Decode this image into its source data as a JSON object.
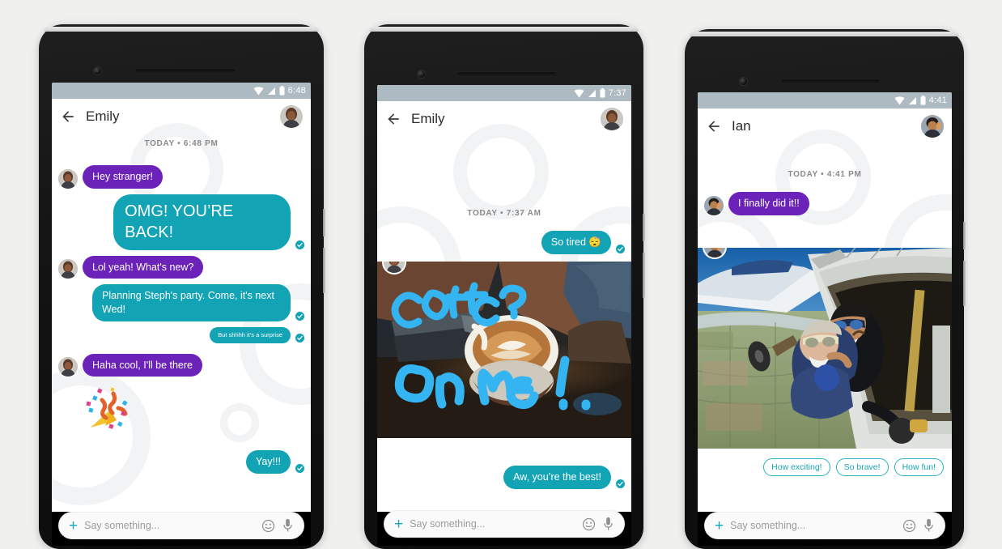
{
  "page": {
    "background": "#f0f0ef"
  },
  "colors": {
    "them_bubble": "#6b22b8",
    "me_bubble": "#12a3b4",
    "accent": "#18a9b6",
    "statusbar": "#adbac2",
    "chip_border": "#27b3c0"
  },
  "phones": [
    {
      "id": "phone-1",
      "status": {
        "time": "6:48",
        "icons": [
          "wifi-icon",
          "signal-icon",
          "battery-icon"
        ]
      },
      "appbar": {
        "back": "back-arrow-icon",
        "title": "Emily",
        "avatar": "contact-avatar-emily"
      },
      "daystamp": "TODAY • 6:48 PM",
      "messages": [
        {
          "side": "them",
          "text": "Hey stranger!",
          "avatar": true,
          "size": "normal",
          "tick": false
        },
        {
          "side": "me",
          "text": "OMG! YOU’RE BACK!",
          "size": "big",
          "tick": true
        },
        {
          "side": "them",
          "text": "Lol yeah! What's new?",
          "avatar": true,
          "size": "normal",
          "tick": false
        },
        {
          "side": "me",
          "text": "Planning Steph's party. Come, it's next Wed!",
          "size": "normal",
          "tick": true
        },
        {
          "side": "me",
          "text": "But shhhh it's a surprise",
          "size": "tiny",
          "tick": true
        },
        {
          "side": "them",
          "text": "Haha cool, I'll be there",
          "avatar": true,
          "size": "normal",
          "tick": false
        },
        {
          "side": "them",
          "type": "sticker",
          "sticker": "party-popper-sticker"
        },
        {
          "side": "me",
          "text": "Yay!!!",
          "size": "normal",
          "tick": true
        }
      ],
      "composer": {
        "plus": "add-attachment-icon",
        "placeholder": "Say something...",
        "emoji": "emoji-icon",
        "mic": "microphone-icon"
      },
      "nav": [
        "back-nav-icon",
        "home-nav-icon",
        "recents-nav-icon"
      ]
    },
    {
      "id": "phone-2",
      "status": {
        "time": "7:37",
        "icons": [
          "wifi-icon",
          "signal-icon",
          "battery-icon"
        ]
      },
      "appbar": {
        "back": "back-arrow-icon",
        "title": "Emily",
        "avatar": "contact-avatar-emily"
      },
      "daystamp": "TODAY • 7:37 AM",
      "messages": [
        {
          "side": "me",
          "text": "So tired 😴",
          "size": "normal",
          "tick": true
        },
        {
          "side": "them",
          "type": "photo",
          "photo": "coffee-photo",
          "annotation_line1": "Coffee?",
          "annotation_line2": "On Me!",
          "avatar": true
        },
        {
          "side": "me",
          "text": "Aw, you’re the best!",
          "size": "normal",
          "tick": true
        }
      ],
      "composer": {
        "plus": "add-attachment-icon",
        "placeholder": "Say something...",
        "emoji": "emoji-icon",
        "mic": "microphone-icon"
      },
      "nav": [
        "back-nav-icon",
        "home-nav-icon",
        "recents-nav-icon"
      ]
    },
    {
      "id": "phone-3",
      "status": {
        "time": "4:41",
        "icons": [
          "wifi-icon",
          "signal-icon",
          "battery-icon"
        ]
      },
      "appbar": {
        "back": "back-arrow-icon",
        "title": "Ian",
        "avatar": "contact-avatar-ian"
      },
      "daystamp": "TODAY • 4:41 PM",
      "messages": [
        {
          "side": "them",
          "text": "I finally did it!!",
          "avatar": true,
          "size": "normal",
          "tick": false
        },
        {
          "side": "them",
          "type": "photo",
          "photo": "skydiving-photo",
          "avatar": true
        }
      ],
      "suggestions": [
        "How exciting!",
        "So brave!",
        "How fun!"
      ],
      "composer": {
        "plus": "add-attachment-icon",
        "placeholder": "Say something...",
        "emoji": "emoji-icon",
        "mic": "microphone-icon"
      },
      "nav": [
        "back-nav-icon",
        "home-nav-icon",
        "recents-nav-icon"
      ]
    }
  ]
}
